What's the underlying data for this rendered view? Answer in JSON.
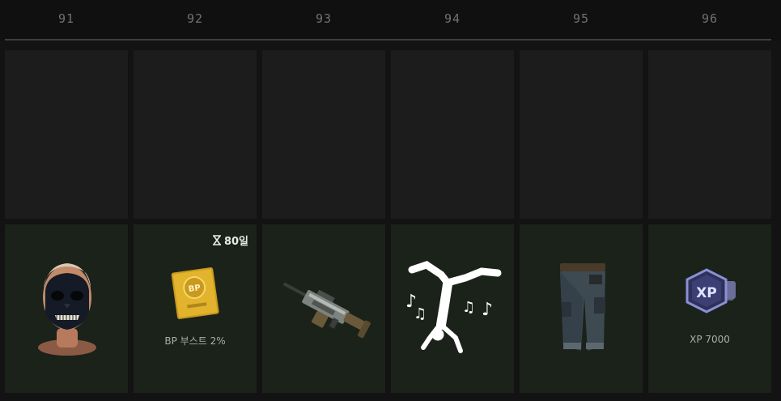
{
  "levels": [
    "91",
    "92",
    "93",
    "94",
    "95",
    "96"
  ],
  "rewards": [
    {
      "icon": "skull-face-paint-icon",
      "label": ""
    },
    {
      "icon": "bp-boost-card-icon",
      "label": "BP 부스트 2%",
      "timer": "80일"
    },
    {
      "icon": "machine-gun-skin-icon",
      "label": ""
    },
    {
      "icon": "breakdance-emote-icon",
      "label": ""
    },
    {
      "icon": "cargo-pants-icon",
      "label": ""
    },
    {
      "icon": "xp-badge-icon",
      "label": "XP 7000"
    }
  ],
  "colors": {
    "background": "#121312",
    "locked_slot": "#1b1c1b",
    "reward_slot": "#1b2219",
    "level_text": "#6f7370"
  }
}
